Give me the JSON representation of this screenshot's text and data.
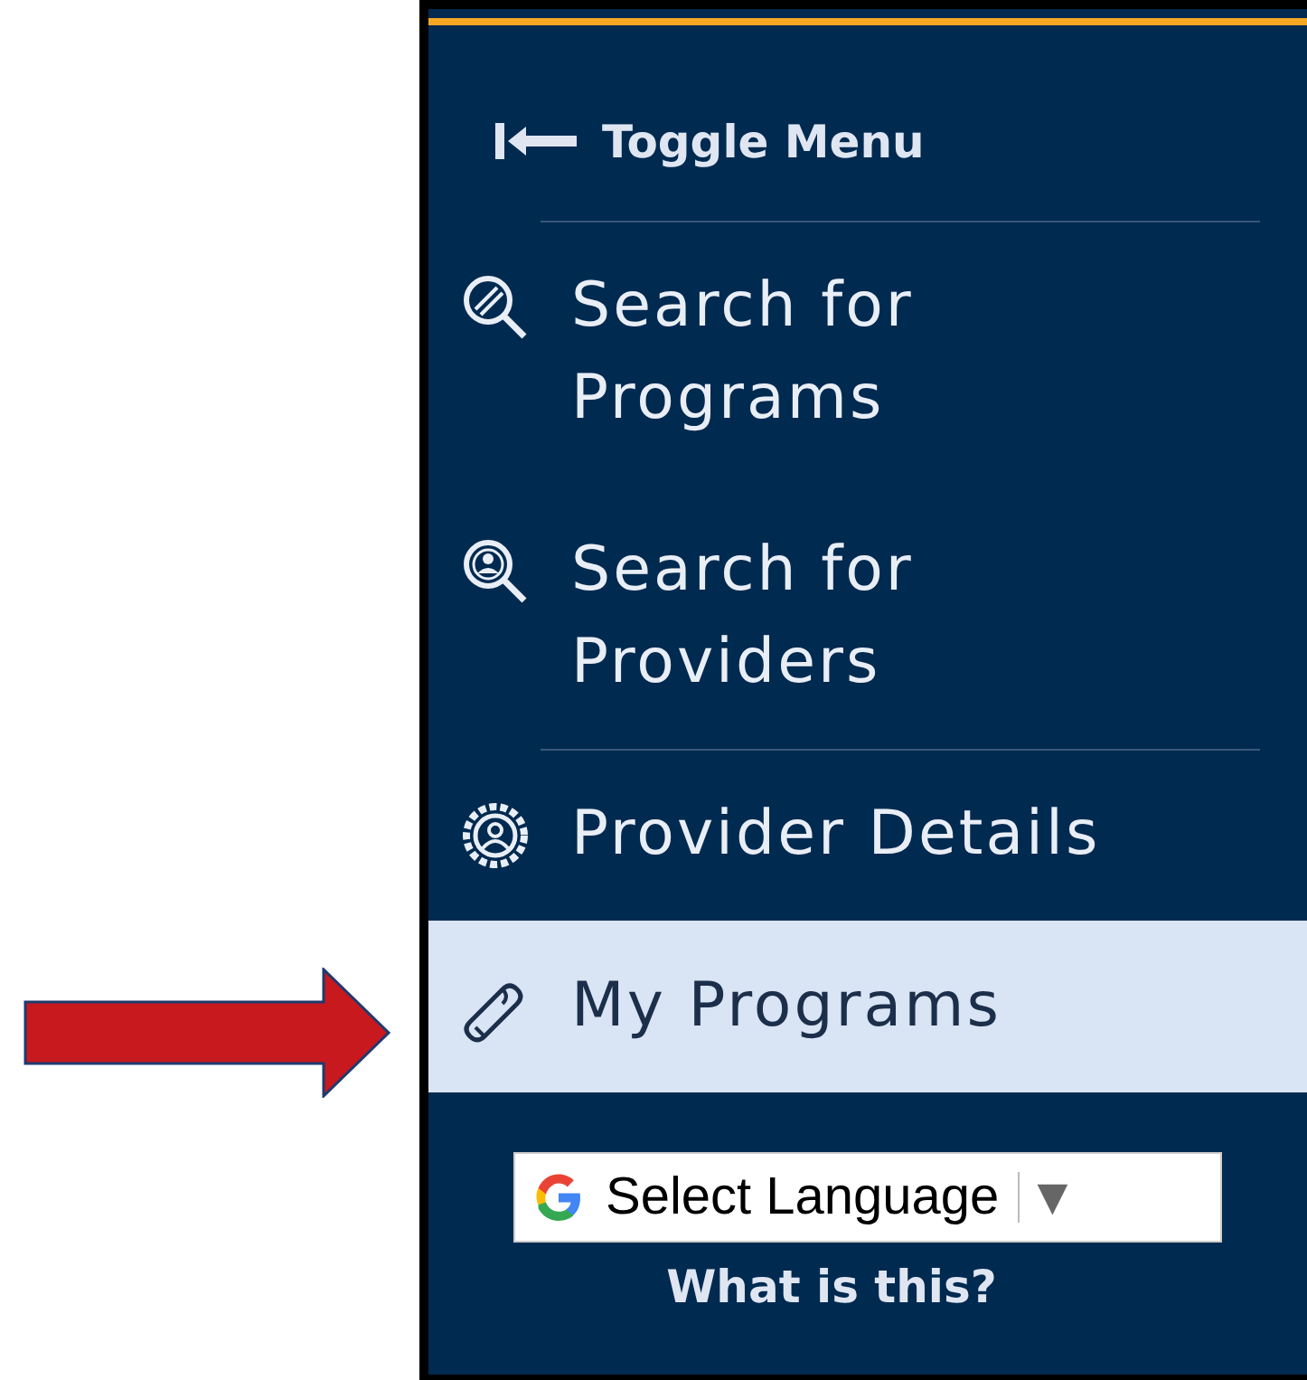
{
  "menu_toggle": {
    "label": "Toggle Menu"
  },
  "nav_items": [
    {
      "label_lines": [
        "Search for",
        "Programs"
      ],
      "kind": "search-programs",
      "divider_before": true,
      "selected": false
    },
    {
      "label_lines": [
        "Search for",
        "Providers"
      ],
      "kind": "search-providers",
      "divider_before": false,
      "selected": false
    },
    {
      "label_lines": [
        "Provider Details"
      ],
      "kind": "provider",
      "divider_before": true,
      "selected": false
    },
    {
      "label_lines": [
        "My Programs"
      ],
      "kind": "programs",
      "divider_before": false,
      "selected": true
    }
  ],
  "language_select": {
    "value": "Select Language",
    "arrow": "▼"
  },
  "help_link": "What is this?"
}
